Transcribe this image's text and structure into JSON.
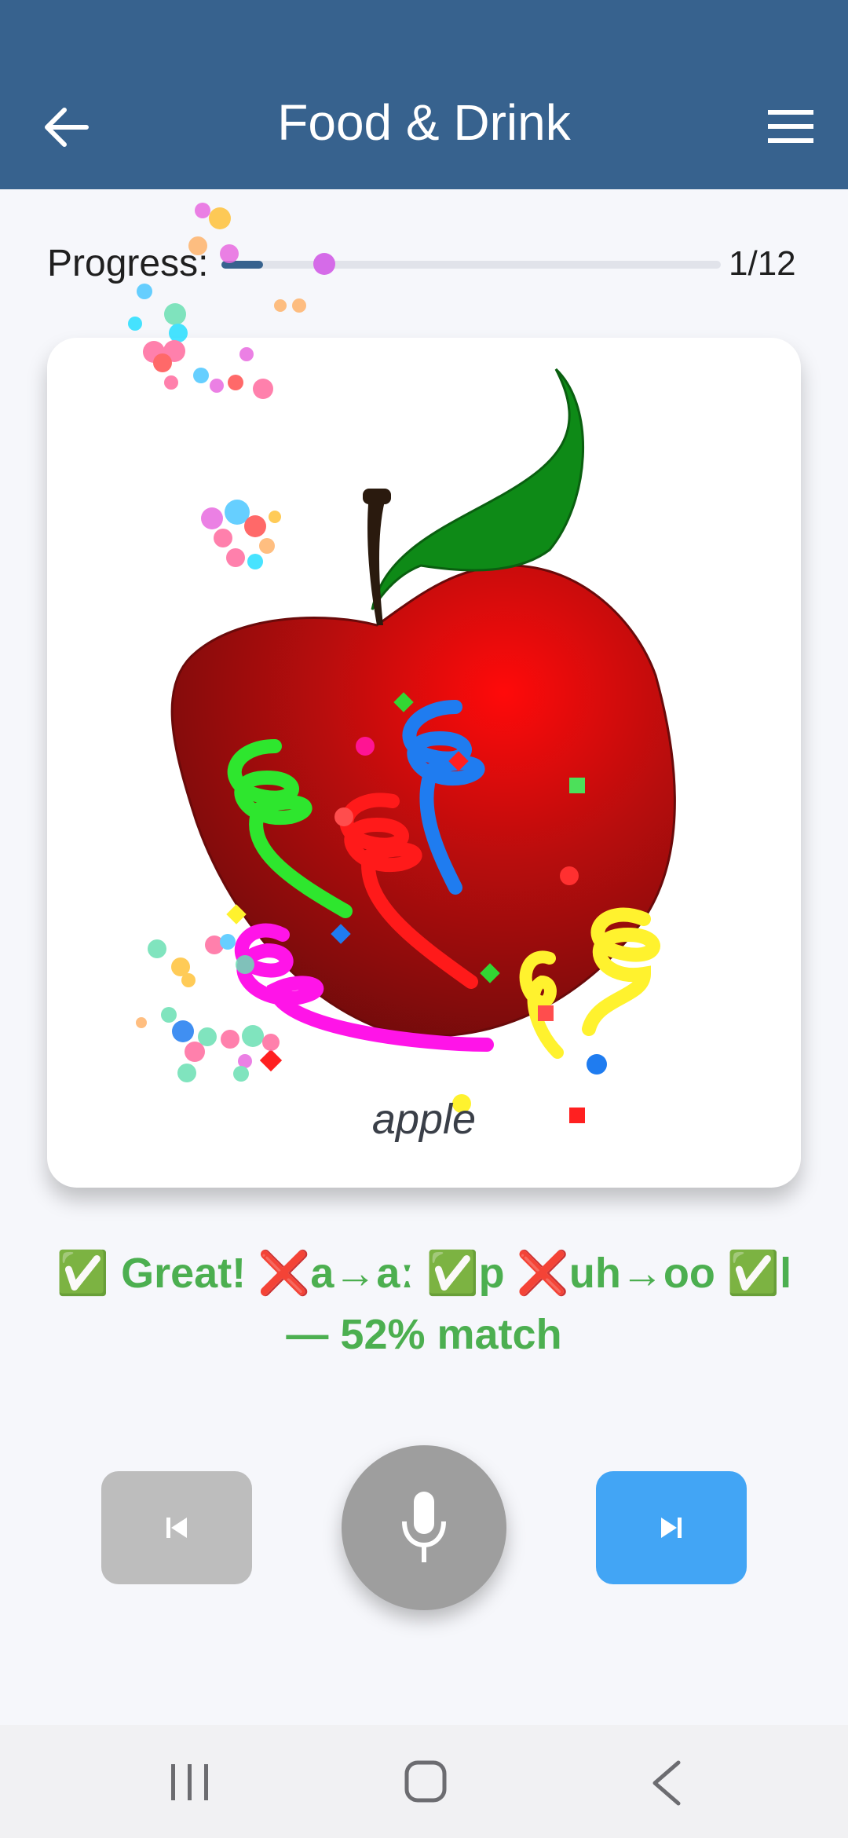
{
  "header": {
    "title": "Food & Drink",
    "back_icon": "arrow-left-icon",
    "menu_icon": "hamburger-menu-icon",
    "background": "#37628e"
  },
  "progress": {
    "label": "Progress:",
    "count": "1/12",
    "fraction": 0.083
  },
  "card": {
    "word": "apple",
    "image": "apple-illustration"
  },
  "feedback": {
    "text": "✅ Great! ❌a→aː ✅p ❌uh→oo ✅l — 52% match",
    "color": "#4caf50"
  },
  "controls": {
    "prev_icon": "skip-previous-icon",
    "mic_icon": "microphone-icon",
    "next_icon": "skip-next-icon",
    "prev_color": "#bdbdbd",
    "mic_color": "#9e9e9e",
    "next_color": "#42a5f5"
  },
  "system_nav": {
    "recents_icon": "recents-icon",
    "home_icon": "home-icon",
    "back_icon": "back-chevron-icon"
  }
}
